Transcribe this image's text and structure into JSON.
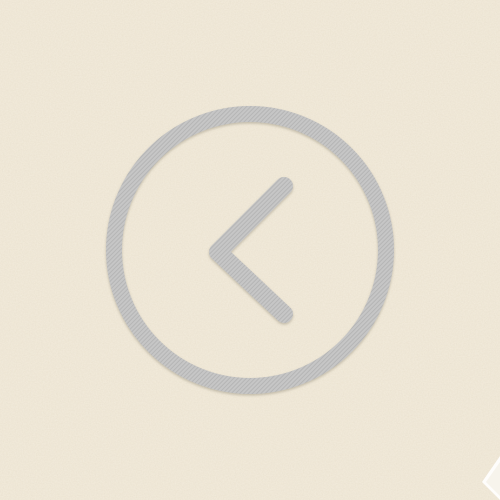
{
  "background": {
    "color": "#f0e8d7",
    "texture": "recycled-paper-grain",
    "speckle_color": "#d9cdb4"
  },
  "back_button": {
    "icon": "chevron-left-icon",
    "shape": "circle-outline",
    "stroke_color": "#c4c4c4",
    "stripe_color": "#b7b7b7",
    "shadow_color": "#8c8471"
  },
  "corner": {
    "icon": "page-curl-icon",
    "color": "#ffffff"
  }
}
